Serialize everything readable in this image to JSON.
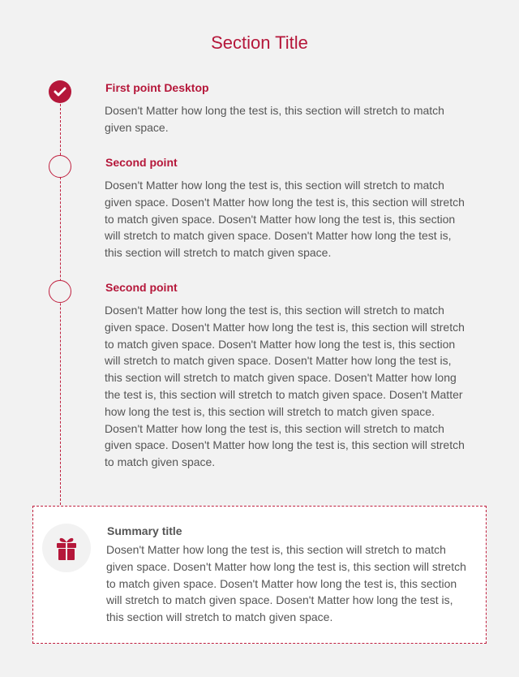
{
  "section": {
    "title": "Section Title"
  },
  "steps": [
    {
      "title": "First point Desktop",
      "body": "Dosen't Matter how long the test is, this section will stretch to match given space.",
      "status": "completed"
    },
    {
      "title": "Second point",
      "body": "Dosen't Matter how long the test is, this section will stretch to match given space. Dosen't Matter how long the test is, this section will stretch to match given space. Dosen't Matter how long the test is, this section will stretch to match given space. Dosen't Matter how long the test is, this section will stretch to match given space.",
      "status": "pending"
    },
    {
      "title": "Second point",
      "body": "Dosen't Matter how long the test is, this section will stretch to match given space. Dosen't Matter how long the test is, this section will stretch to match given space. Dosen't Matter how long the test is, this section will stretch to match given space. Dosen't Matter how long the test is, this section will stretch to match given space. Dosen't Matter how long the test is, this section will stretch to match given space. Dosen't Matter how long the test is, this section will stretch to match given space. Dosen't Matter how long the test is, this section will stretch to match given space. Dosen't Matter how long the test is, this section will stretch to match given space.",
      "status": "pending"
    }
  ],
  "summary": {
    "icon": "gift-icon",
    "title": "Summary title",
    "body": "Dosen't Matter how long the test is, this section will stretch to match given space. Dosen't Matter how long the test is, this section will stretch to match given space. Dosen't Matter how long the test is, this section will stretch to match given space. Dosen't Matter how long the test is, this section will stretch to match given space."
  },
  "colors": {
    "accent": "#b5173a",
    "background": "#f2f2f2",
    "text": "#555555",
    "card": "#ffffff"
  },
  "icons": {
    "completed": "check-circle-icon",
    "pending": "empty-circle-icon"
  }
}
